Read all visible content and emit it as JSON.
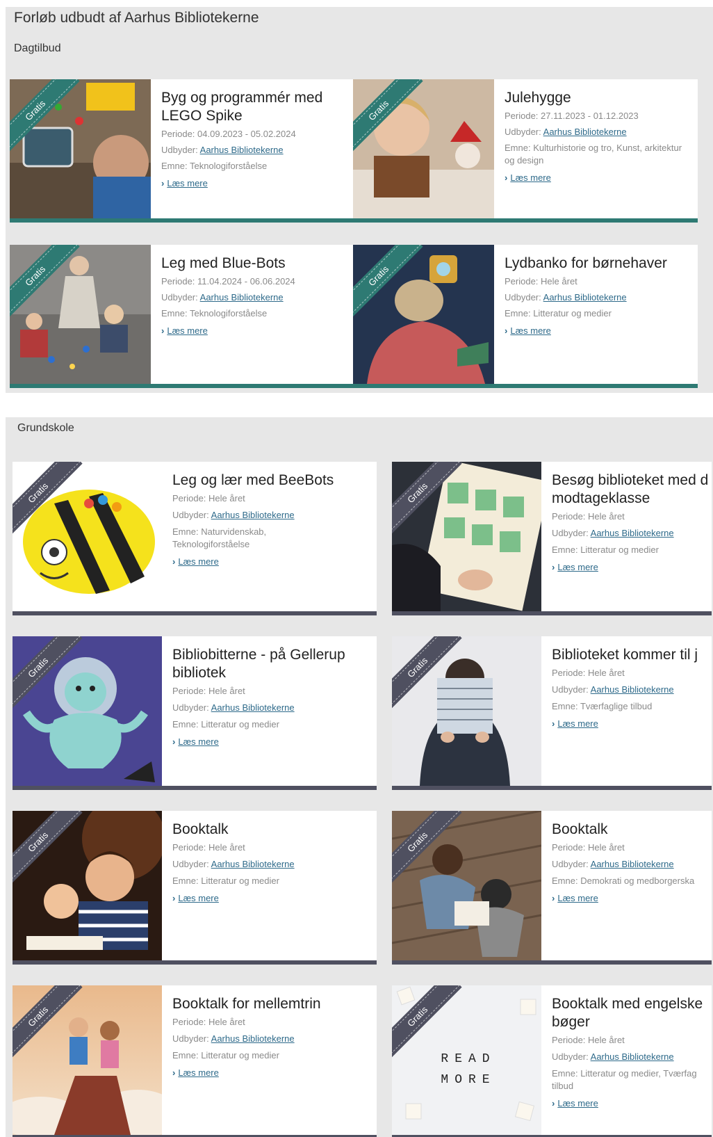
{
  "page": {
    "title": "Forløb udbudt af Aarhus Bibliotekerne"
  },
  "labels": {
    "periode": "Periode:",
    "udbyder": "Udbyder:",
    "emne": "Emne:",
    "read_more": "Læs mere",
    "badge": "Gratis"
  },
  "colors": {
    "teal": "#2e7a73",
    "slate": "#4f5060",
    "link": "#2e6a8a",
    "section_bg": "#e7e7e7"
  },
  "sections": [
    {
      "label": "Dagtilbud",
      "cards": [
        {
          "title": "Byg og programmér med LEGO Spike",
          "periode": "04.09.2023 - 05.02.2024",
          "udbyder": "Aarhus Bibliotekerne",
          "emne": "Teknologiforståelse"
        },
        {
          "title": "Julehygge",
          "periode": "27.11.2023 - 01.12.2023",
          "udbyder": "Aarhus Bibliotekerne",
          "emne": "Kulturhistorie og tro, Kunst, arkitektur og design"
        },
        {
          "title": "Leg med Blue-Bots",
          "periode": "11.04.2024 - 06.06.2024",
          "udbyder": "Aarhus Bibliotekerne",
          "emne": "Teknologiforståelse"
        },
        {
          "title": "Lydbanko for børnehaver",
          "periode": "Hele året",
          "udbyder": "Aarhus Bibliotekerne",
          "emne": "Litteratur og medier"
        }
      ]
    },
    {
      "label": "Grundskole",
      "cards": [
        {
          "title": "Leg og lær med BeeBots",
          "periode": "Hele året",
          "udbyder": "Aarhus Bibliotekerne",
          "emne": "Naturvidenskab, Teknologiforståelse"
        },
        {
          "title": "Besøg biblioteket med d modtageklasse",
          "periode": "Hele året",
          "udbyder": "Aarhus Bibliotekerne",
          "emne": "Litteratur og medier"
        },
        {
          "title": "Bibliobitterne - på Gellerup bibliotek",
          "periode": "Hele året",
          "udbyder": "Aarhus Bibliotekerne",
          "emne": "Litteratur og medier"
        },
        {
          "title": "Biblioteket kommer til j",
          "periode": "Hele året",
          "udbyder": "Aarhus Bibliotekerne",
          "emne": "Tværfaglige tilbud"
        },
        {
          "title": "Booktalk",
          "periode": "Hele året",
          "udbyder": "Aarhus Bibliotekerne",
          "emne": "Litteratur og medier"
        },
        {
          "title": "Booktalk",
          "periode": "Hele året",
          "udbyder": "Aarhus Bibliotekerne",
          "emne": "Demokrati og medborgerska"
        },
        {
          "title": "Booktalk for mellemtrin",
          "periode": "Hele året",
          "udbyder": "Aarhus Bibliotekerne",
          "emne": "Litteratur og medier"
        },
        {
          "title": "Booktalk med engelske bøger",
          "periode": "Hele året",
          "udbyder": "Aarhus Bibliotekerne",
          "emne": "Litteratur og medier, Tværfag tilbud"
        }
      ],
      "image_text": {
        "read": "READ",
        "more": "MORE"
      }
    }
  ]
}
